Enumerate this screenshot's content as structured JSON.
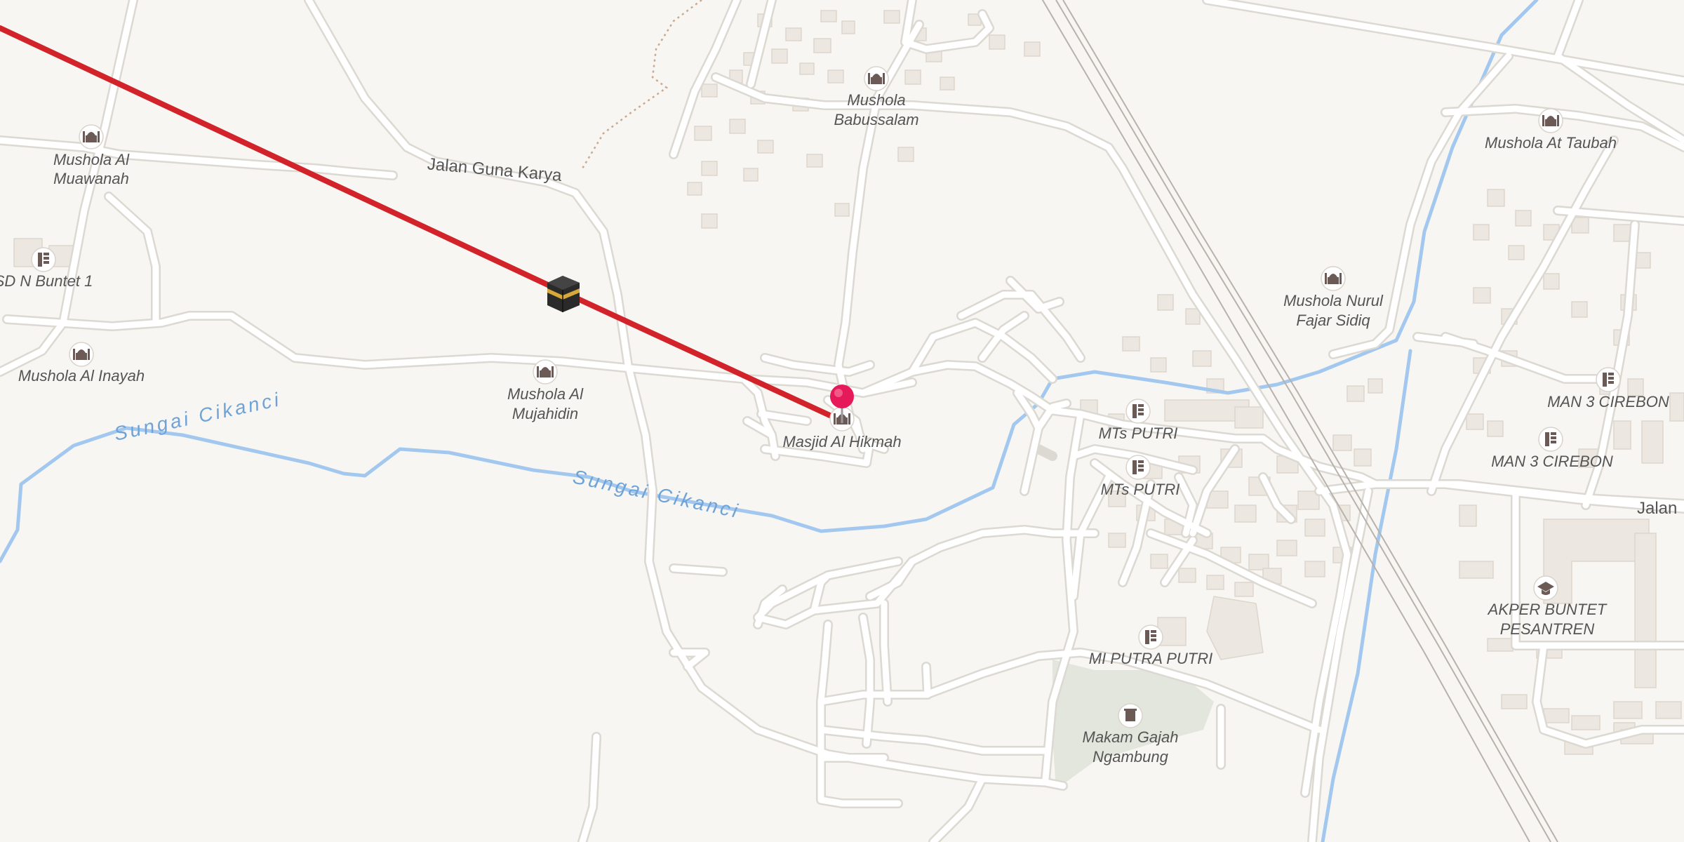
{
  "colors": {
    "background": "#f8f6f2",
    "qibla_line": "#d2232a",
    "river": "#a3c8ef",
    "pin": "#e6195a",
    "cemetery": "#e2e6dc"
  },
  "roads": {
    "guna_karya": "Jalan Guna Karya",
    "jalan_east": "Jalan"
  },
  "rivers": {
    "upper": "Sungai Cikanci",
    "lower": "Sungai Cikanci"
  },
  "places": {
    "mushola_al_muawanah": [
      "Mushola Al",
      "Muawanah"
    ],
    "sd_buntet": "SD N Buntet 1",
    "mushola_al_inayah": "Mushola Al Inayah",
    "mushola_al_mujahidin": [
      "Mushola Al",
      "Mujahidin"
    ],
    "mushola_babussalam": [
      "Mushola",
      "Babussalam"
    ],
    "masjid_al_hikmah": "Masjid Al Hikmah",
    "mushola_at_taubah": "Mushola At Taubah",
    "mushola_nurul_fajar": [
      "Mushola Nurul",
      "Fajar Sidiq"
    ],
    "mts_putri_1": "MTs PUTRI",
    "mts_putri_2": "MTs PUTRI",
    "man3_1": "MAN 3 CIREBON",
    "man3_2": "MAN 3 CIREBON",
    "akper": [
      "AKPER BUNTET",
      "PESANTREN"
    ],
    "mi_putra_putri": "MI PUTRA PUTRI",
    "makam": [
      "Makam Gajah",
      "Ngambung"
    ]
  },
  "icons": {
    "mosque": "mosque-icon",
    "school": "school-icon",
    "college": "graduation-cap-icon",
    "cemetery": "cemetery-icon",
    "kaaba": "kaaba-icon",
    "pin": "location-pin-icon"
  }
}
